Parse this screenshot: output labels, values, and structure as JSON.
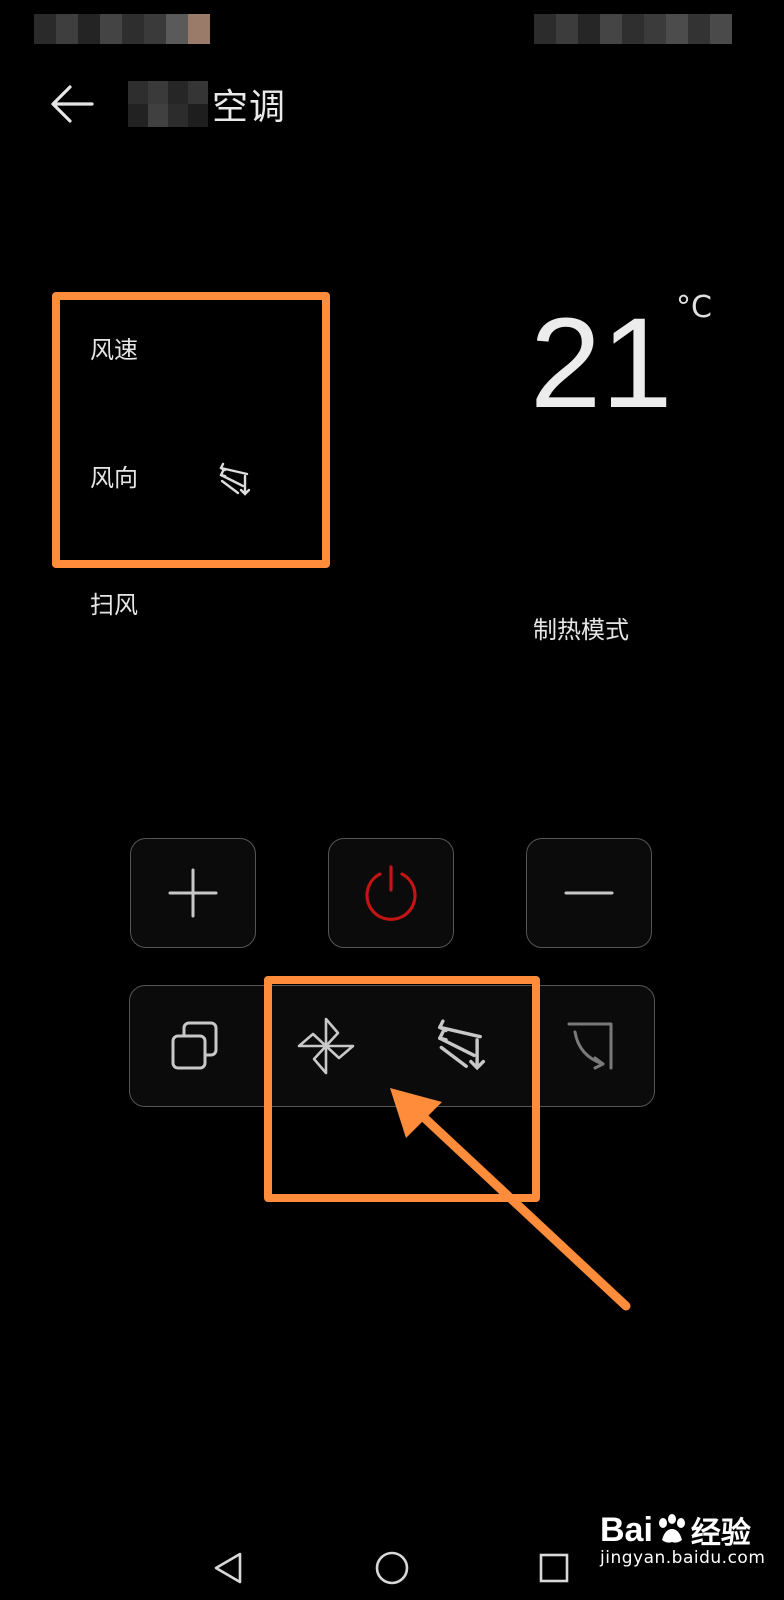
{
  "header": {
    "title": "空调"
  },
  "panel": {
    "wind_speed_label": "风速",
    "wind_direction_label": "风向",
    "swing_label": "扫风"
  },
  "temperature": {
    "value": "21",
    "unit": "°C",
    "mode": "制热模式"
  },
  "controls": {
    "row1": [
      "plus-icon",
      "power-icon",
      "minus-icon"
    ],
    "row2": [
      "copy-icon",
      "fan-icon",
      "wind-direction-icon",
      "swing-icon"
    ]
  },
  "colors": {
    "accent_annotation": "#FF8C3A",
    "power": "#C41414",
    "background": "#000000"
  },
  "watermark": {
    "brand_left": "Bai",
    "brand_right": "经验",
    "site": "jingyan.baidu.com"
  }
}
